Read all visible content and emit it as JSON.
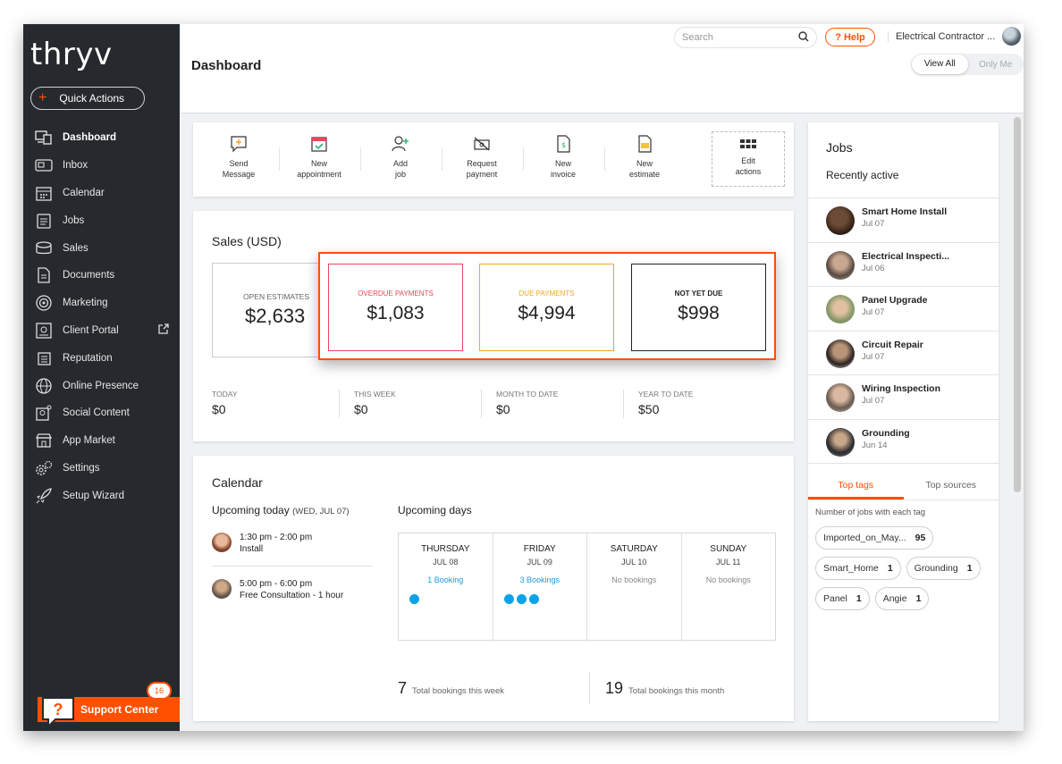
{
  "app": {
    "logo": "thryv",
    "quick_actions": "Quick Actions"
  },
  "sidebar": {
    "items": [
      {
        "label": "Dashboard",
        "icon": "dashboard-icon"
      },
      {
        "label": "Inbox",
        "icon": "inbox-icon"
      },
      {
        "label": "Calendar",
        "icon": "calendar-icon"
      },
      {
        "label": "Jobs",
        "icon": "jobs-icon"
      },
      {
        "label": "Sales",
        "icon": "sales-icon"
      },
      {
        "label": "Documents",
        "icon": "documents-icon"
      },
      {
        "label": "Marketing",
        "icon": "marketing-icon"
      },
      {
        "label": "Client Portal",
        "icon": "client-portal-icon"
      },
      {
        "label": "Reputation",
        "icon": "reputation-icon"
      },
      {
        "label": "Online Presence",
        "icon": "globe-icon"
      },
      {
        "label": "Social Content",
        "icon": "social-content-icon"
      },
      {
        "label": "App Market",
        "icon": "app-market-icon"
      },
      {
        "label": "Settings",
        "icon": "gear-icon"
      },
      {
        "label": "Setup Wizard",
        "icon": "rocket-icon"
      }
    ],
    "support": {
      "label": "Support Center",
      "badge": "16"
    }
  },
  "header": {
    "title": "Dashboard",
    "search_placeholder": "Search",
    "help": "Help",
    "account": "Electrical Contractor ...",
    "toggle": {
      "all": "View All",
      "mine": "Only Me"
    }
  },
  "quick_actions": {
    "items": [
      {
        "line1": "Send",
        "line2": "Message"
      },
      {
        "line1": "New",
        "line2": "appointment"
      },
      {
        "line1": "Add",
        "line2": "job"
      },
      {
        "line1": "Request",
        "line2": "payment"
      },
      {
        "line1": "New",
        "line2": "invoice"
      },
      {
        "line1": "New",
        "line2": "estimate"
      }
    ],
    "edit": {
      "line1": "Edit",
      "line2": "actions"
    }
  },
  "sales": {
    "title": "Sales (USD)",
    "open_estimates": {
      "label": "OPEN ESTIMATES",
      "value": "$2,633"
    },
    "overdue": {
      "label": "OVERDUE PAYMENTS",
      "value": "$1,083",
      "color": "#e8485a"
    },
    "due": {
      "label": "DUE PAYMENTS",
      "value": "$4,994",
      "color": "#f5a623"
    },
    "not_due": {
      "label": "NOT YET DUE",
      "value": "$998",
      "color": "#222222"
    },
    "periods": [
      {
        "label": "TODAY",
        "value": "$0"
      },
      {
        "label": "THIS WEEK",
        "value": "$0"
      },
      {
        "label": "MONTH TO DATE",
        "value": "$0"
      },
      {
        "label": "YEAR TO DATE",
        "value": "$50"
      }
    ]
  },
  "calendar": {
    "title": "Calendar",
    "today_label": "Upcoming today",
    "today_date": "(WED, JUL 07)",
    "appointments": [
      {
        "time": "1:30 pm - 2:00 pm",
        "desc": "Install"
      },
      {
        "time": "5:00 pm - 6:00 pm",
        "desc": "Free Consultation - 1 hour"
      }
    ],
    "upcoming_label": "Upcoming days",
    "days": [
      {
        "name": "THURSDAY",
        "date": "JUL 08",
        "bookings": "1 Booking",
        "count": 1
      },
      {
        "name": "FRIDAY",
        "date": "JUL 09",
        "bookings": "3 Bookings",
        "count": 3
      },
      {
        "name": "SATURDAY",
        "date": "JUL 10",
        "bookings": "No bookings",
        "count": 0
      },
      {
        "name": "SUNDAY",
        "date": "JUL 11",
        "bookings": "No bookings",
        "count": 0
      }
    ],
    "week_total": {
      "value": "7",
      "label": "Total bookings this week"
    },
    "month_total": {
      "value": "19",
      "label": "Total bookings this month"
    }
  },
  "jobs": {
    "title": "Jobs",
    "subtitle": "Recently active",
    "items": [
      {
        "name": "Smart Home Install",
        "date": "Jul 07"
      },
      {
        "name": "Electrical Inspecti...",
        "date": "Jul 06"
      },
      {
        "name": "Panel Upgrade",
        "date": "Jul 07"
      },
      {
        "name": "Circuit Repair",
        "date": "Jul 07"
      },
      {
        "name": "Wiring Inspection",
        "date": "Jul 07"
      },
      {
        "name": "Grounding",
        "date": "Jun 14"
      }
    ],
    "tabs": [
      "Top tags",
      "Top sources"
    ],
    "tag_caption": "Number of jobs with each tag",
    "tags": [
      {
        "name": "Imported_on_May...",
        "count": "95"
      },
      {
        "name": "Smart_Home",
        "count": "1"
      },
      {
        "name": "Grounding",
        "count": "1"
      },
      {
        "name": "Panel",
        "count": "1"
      },
      {
        "name": "Angie",
        "count": "1"
      }
    ]
  },
  "colors": {
    "accent": "#ff5000",
    "sidebar": "#262a2e",
    "link": "#1a9be0"
  }
}
